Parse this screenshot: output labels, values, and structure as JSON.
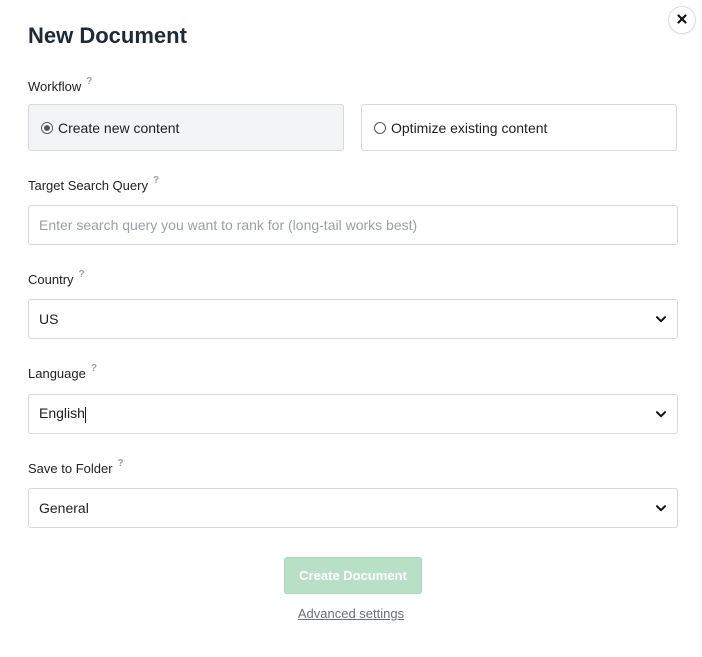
{
  "dialog": {
    "title": "New Document",
    "help_mark": "?"
  },
  "workflow": {
    "label": "Workflow",
    "options": [
      {
        "label": "Create new content",
        "selected": true
      },
      {
        "label": "Optimize existing content",
        "selected": false
      }
    ]
  },
  "query": {
    "label": "Target Search Query",
    "placeholder": "Enter search query you want to rank for (long-tail works best)",
    "value": ""
  },
  "country": {
    "label": "Country",
    "value": "US"
  },
  "language": {
    "label": "Language",
    "value": "English"
  },
  "folder": {
    "label": "Save to Folder",
    "value": "General"
  },
  "actions": {
    "create_label": "Create Document",
    "advanced_label": "Advanced settings"
  },
  "colors": {
    "primary_disabled": "#b7e0c6",
    "title": "#1e2a35",
    "border": "#d5d8dc"
  }
}
